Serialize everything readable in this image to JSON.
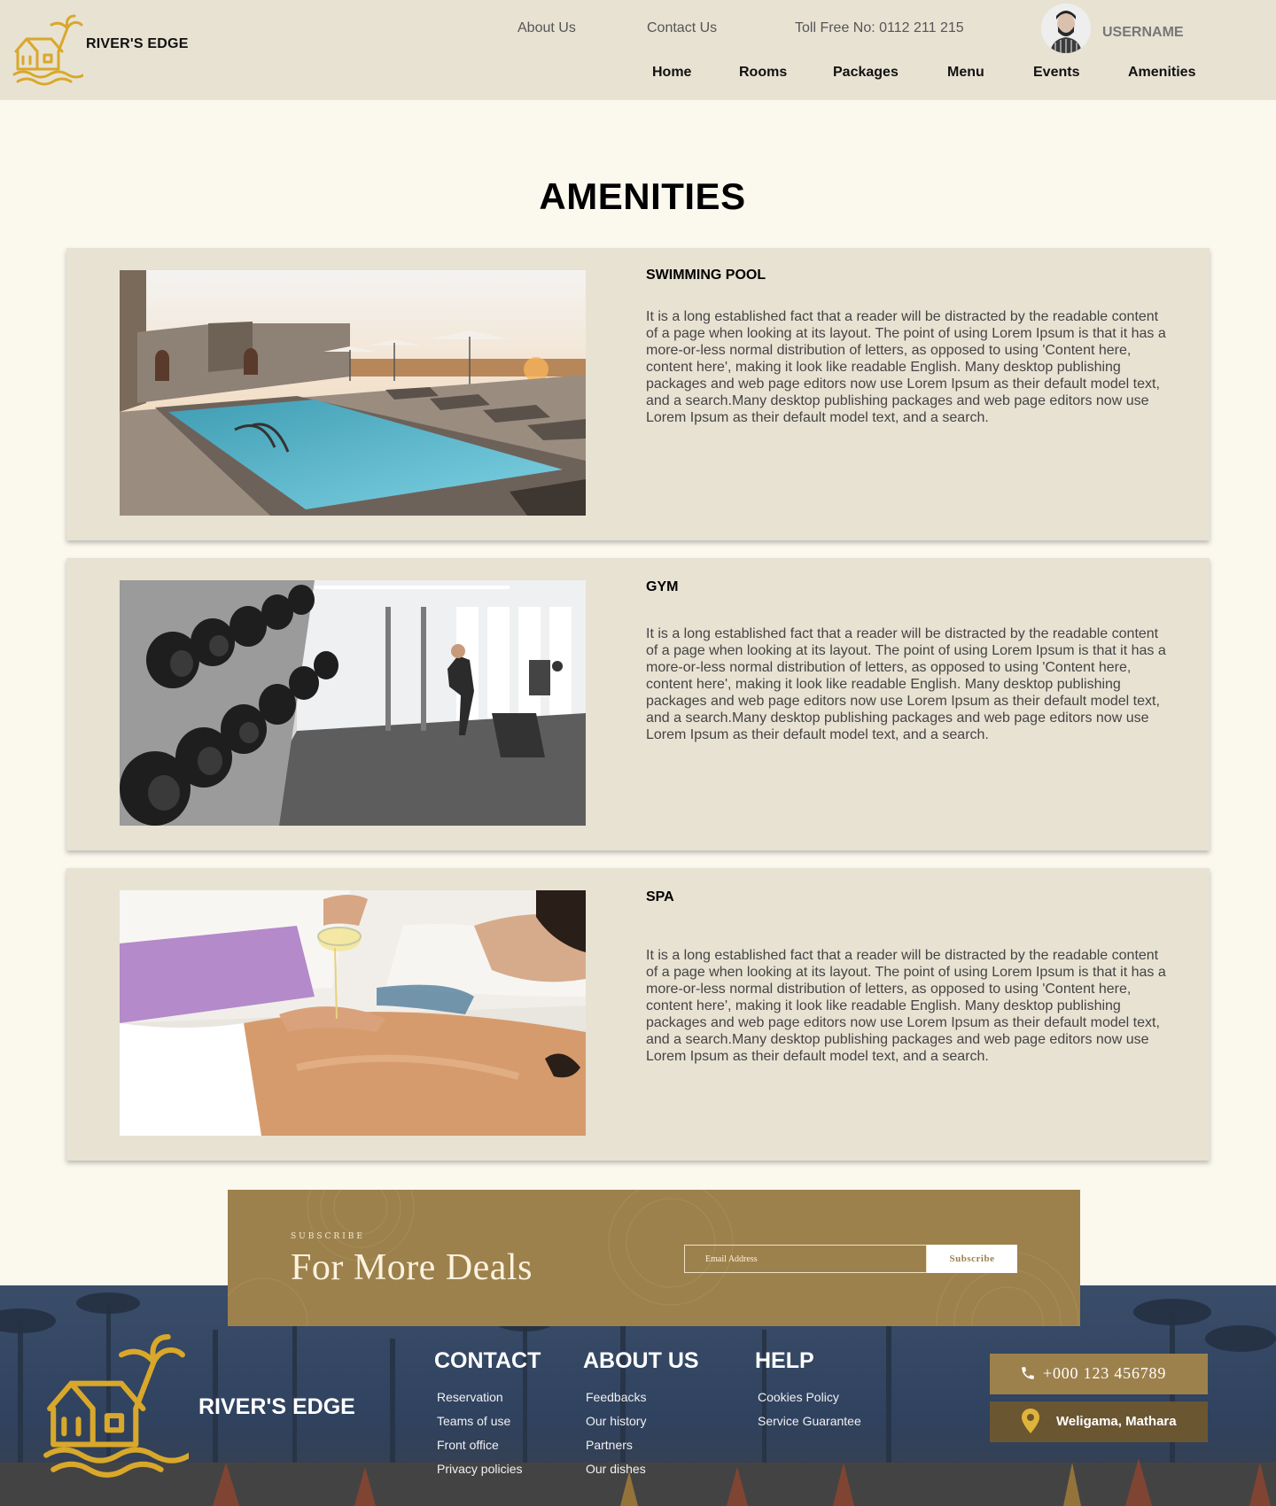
{
  "header": {
    "brand": "RIVER'S EDGE",
    "top_links": [
      "About Us",
      "Contact Us"
    ],
    "toll_free": "Toll Free No: 0112 211 215",
    "username": "USERNAME",
    "nav": [
      "Home",
      "Rooms",
      "Packages",
      "Menu",
      "Events",
      "Amenities"
    ]
  },
  "page": {
    "title": "AMENITIES"
  },
  "amenities": [
    {
      "title": "SWIMMING POOL",
      "image": "pool-photo",
      "text": "It is a long established fact that a reader will be distracted by the readable content of a page when looking at its layout. The point of using Lorem Ipsum is that it has a more-or-less normal distribution of letters, as opposed to using 'Content here, content here', making it look like readable English. Many desktop publishing packages and web page editors now use Lorem Ipsum as their default model text, and a search.Many desktop publishing packages and web page editors now use Lorem Ipsum as their default model text, and a search."
    },
    {
      "title": "GYM",
      "image": "gym-photo",
      "text": "It is a long established fact that a reader will be distracted by the readable content of a page when looking at its layout. The point of using Lorem Ipsum is that it has a more-or-less normal distribution of letters, as opposed to using 'Content here, content here', making it look like readable English. Many desktop publishing packages and web page editors now use Lorem Ipsum as their default model text, and a search.Many desktop publishing packages and web page editors now use Lorem Ipsum as their default model text, and a search."
    },
    {
      "title": "SPA",
      "image": "spa-photo",
      "text": "It is a long established fact that a reader will be distracted by the readable content of a page when looking at its layout. The point of using Lorem Ipsum is that it has a more-or-less normal distribution of letters, as opposed to using 'Content here, content here', making it look like readable English. Many desktop publishing packages and web page editors now use Lorem Ipsum as their default model text, and a search.Many desktop publishing packages and web page editors now use Lorem Ipsum as their default model text, and a search."
    }
  ],
  "subscribe": {
    "kicker": "SUBSCRIBE",
    "title": "For More Deals",
    "email_placeholder": "Email Address",
    "button_label": "Subscribe"
  },
  "footer": {
    "brand": "RIVER'S EDGE",
    "columns": [
      {
        "heading": "CONTACT",
        "links": [
          "Reservation",
          "Teams of use",
          "Front office",
          "Privacy policies"
        ]
      },
      {
        "heading": "ABOUT US",
        "links": [
          "Feedbacks",
          "Our history",
          "Partners",
          "Our dishes"
        ]
      },
      {
        "heading": "HELP",
        "links": [
          "Cookies Policy",
          "Service Guarantee"
        ]
      }
    ],
    "phone": "+000 123 456789",
    "location": "Weligama, Mathara"
  },
  "colors": {
    "header_bg": "#e8e2d3",
    "page_bg": "#fbf8ee",
    "card_bg": "#e8e2d3",
    "accent_gold": "#9d814c",
    "logo_gold": "#d9a82b",
    "location_bg": "#6a5631"
  },
  "icons": [
    "avatar",
    "phone-icon",
    "location-pin-icon",
    "logo-house-icon"
  ]
}
